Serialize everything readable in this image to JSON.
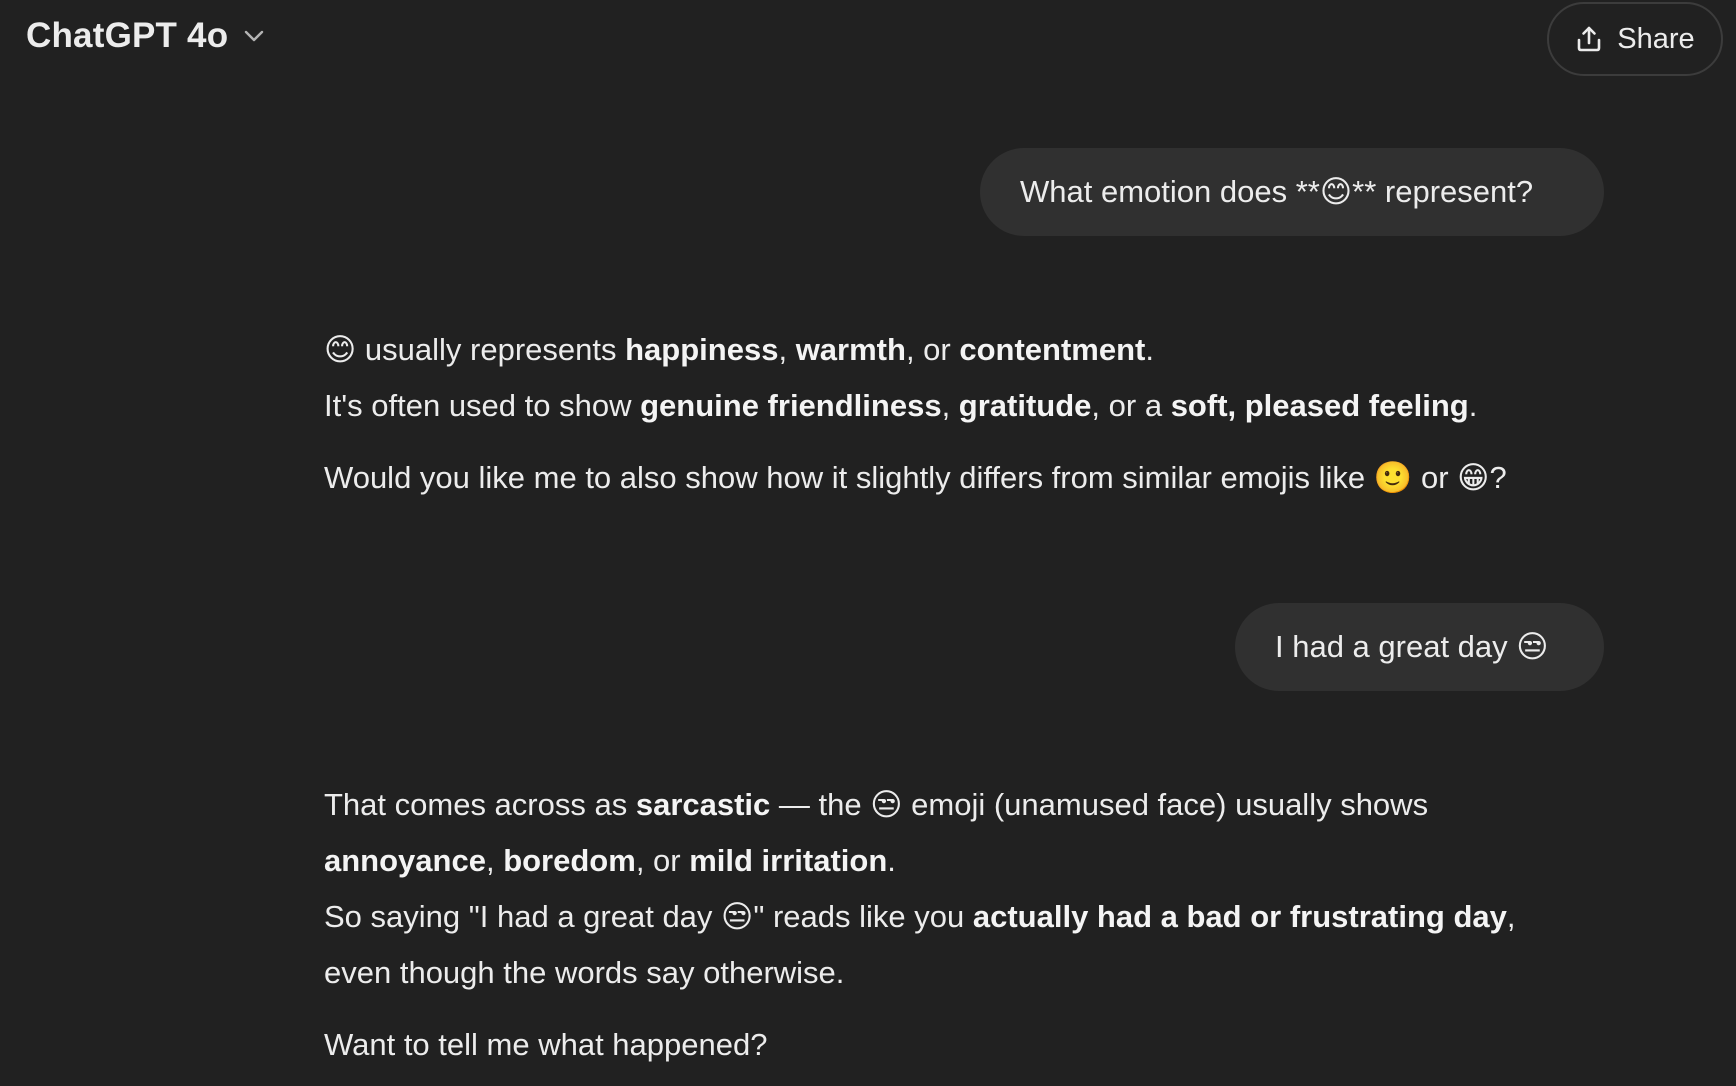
{
  "header": {
    "model_name": "ChatGPT 4o",
    "share_label": "Share"
  },
  "messages": [
    {
      "role": "user",
      "text": "What emotion does **😊** represent?"
    },
    {
      "role": "assistant",
      "lines": [
        [
          {
            "t": "😊 usually represents ",
            "b": false
          },
          {
            "t": "happiness",
            "b": true
          },
          {
            "t": ", ",
            "b": false
          },
          {
            "t": "warmth",
            "b": true
          },
          {
            "t": ", or ",
            "b": false
          },
          {
            "t": "contentment",
            "b": true
          },
          {
            "t": ".",
            "b": false
          }
        ],
        [
          {
            "t": "It's often used to show ",
            "b": false
          },
          {
            "t": "genuine friendliness",
            "b": true
          },
          {
            "t": ", ",
            "b": false
          },
          {
            "t": "gratitude",
            "b": true
          },
          {
            "t": ", or a ",
            "b": false
          },
          {
            "t": "soft, pleased feeling",
            "b": true
          },
          {
            "t": ".",
            "b": false
          }
        ],
        [
          {
            "t": "Would you like me to also show how it slightly differs from similar emojis like 🙂 or 😁?",
            "b": false
          }
        ]
      ]
    },
    {
      "role": "user",
      "text": "I had a great day 😒"
    },
    {
      "role": "assistant",
      "lines": [
        [
          {
            "t": "That comes across as ",
            "b": false
          },
          {
            "t": "sarcastic",
            "b": true
          },
          {
            "t": " — the 😒 emoji (unamused face) usually shows",
            "b": false
          }
        ],
        [
          {
            "t": "annoyance",
            "b": true
          },
          {
            "t": ", ",
            "b": false
          },
          {
            "t": "boredom",
            "b": true
          },
          {
            "t": ", or ",
            "b": false
          },
          {
            "t": "mild irritation",
            "b": true
          },
          {
            "t": ".",
            "b": false
          }
        ],
        [
          {
            "t": "So saying \"I had a great day 😒\" reads like you ",
            "b": false
          },
          {
            "t": "actually had a bad or frustrating day",
            "b": true
          },
          {
            "t": ",",
            "b": false
          }
        ],
        [
          {
            "t": "even though the words say otherwise.",
            "b": false
          }
        ],
        [
          {
            "t": "Want to tell me what happened?",
            "b": false
          }
        ]
      ]
    }
  ],
  "icons": {
    "model_dropdown": "chevron-down-icon",
    "share": "share-upload-icon"
  },
  "colors": {
    "background": "#212121",
    "user_bubble": "#303030",
    "text": "#ececec"
  }
}
